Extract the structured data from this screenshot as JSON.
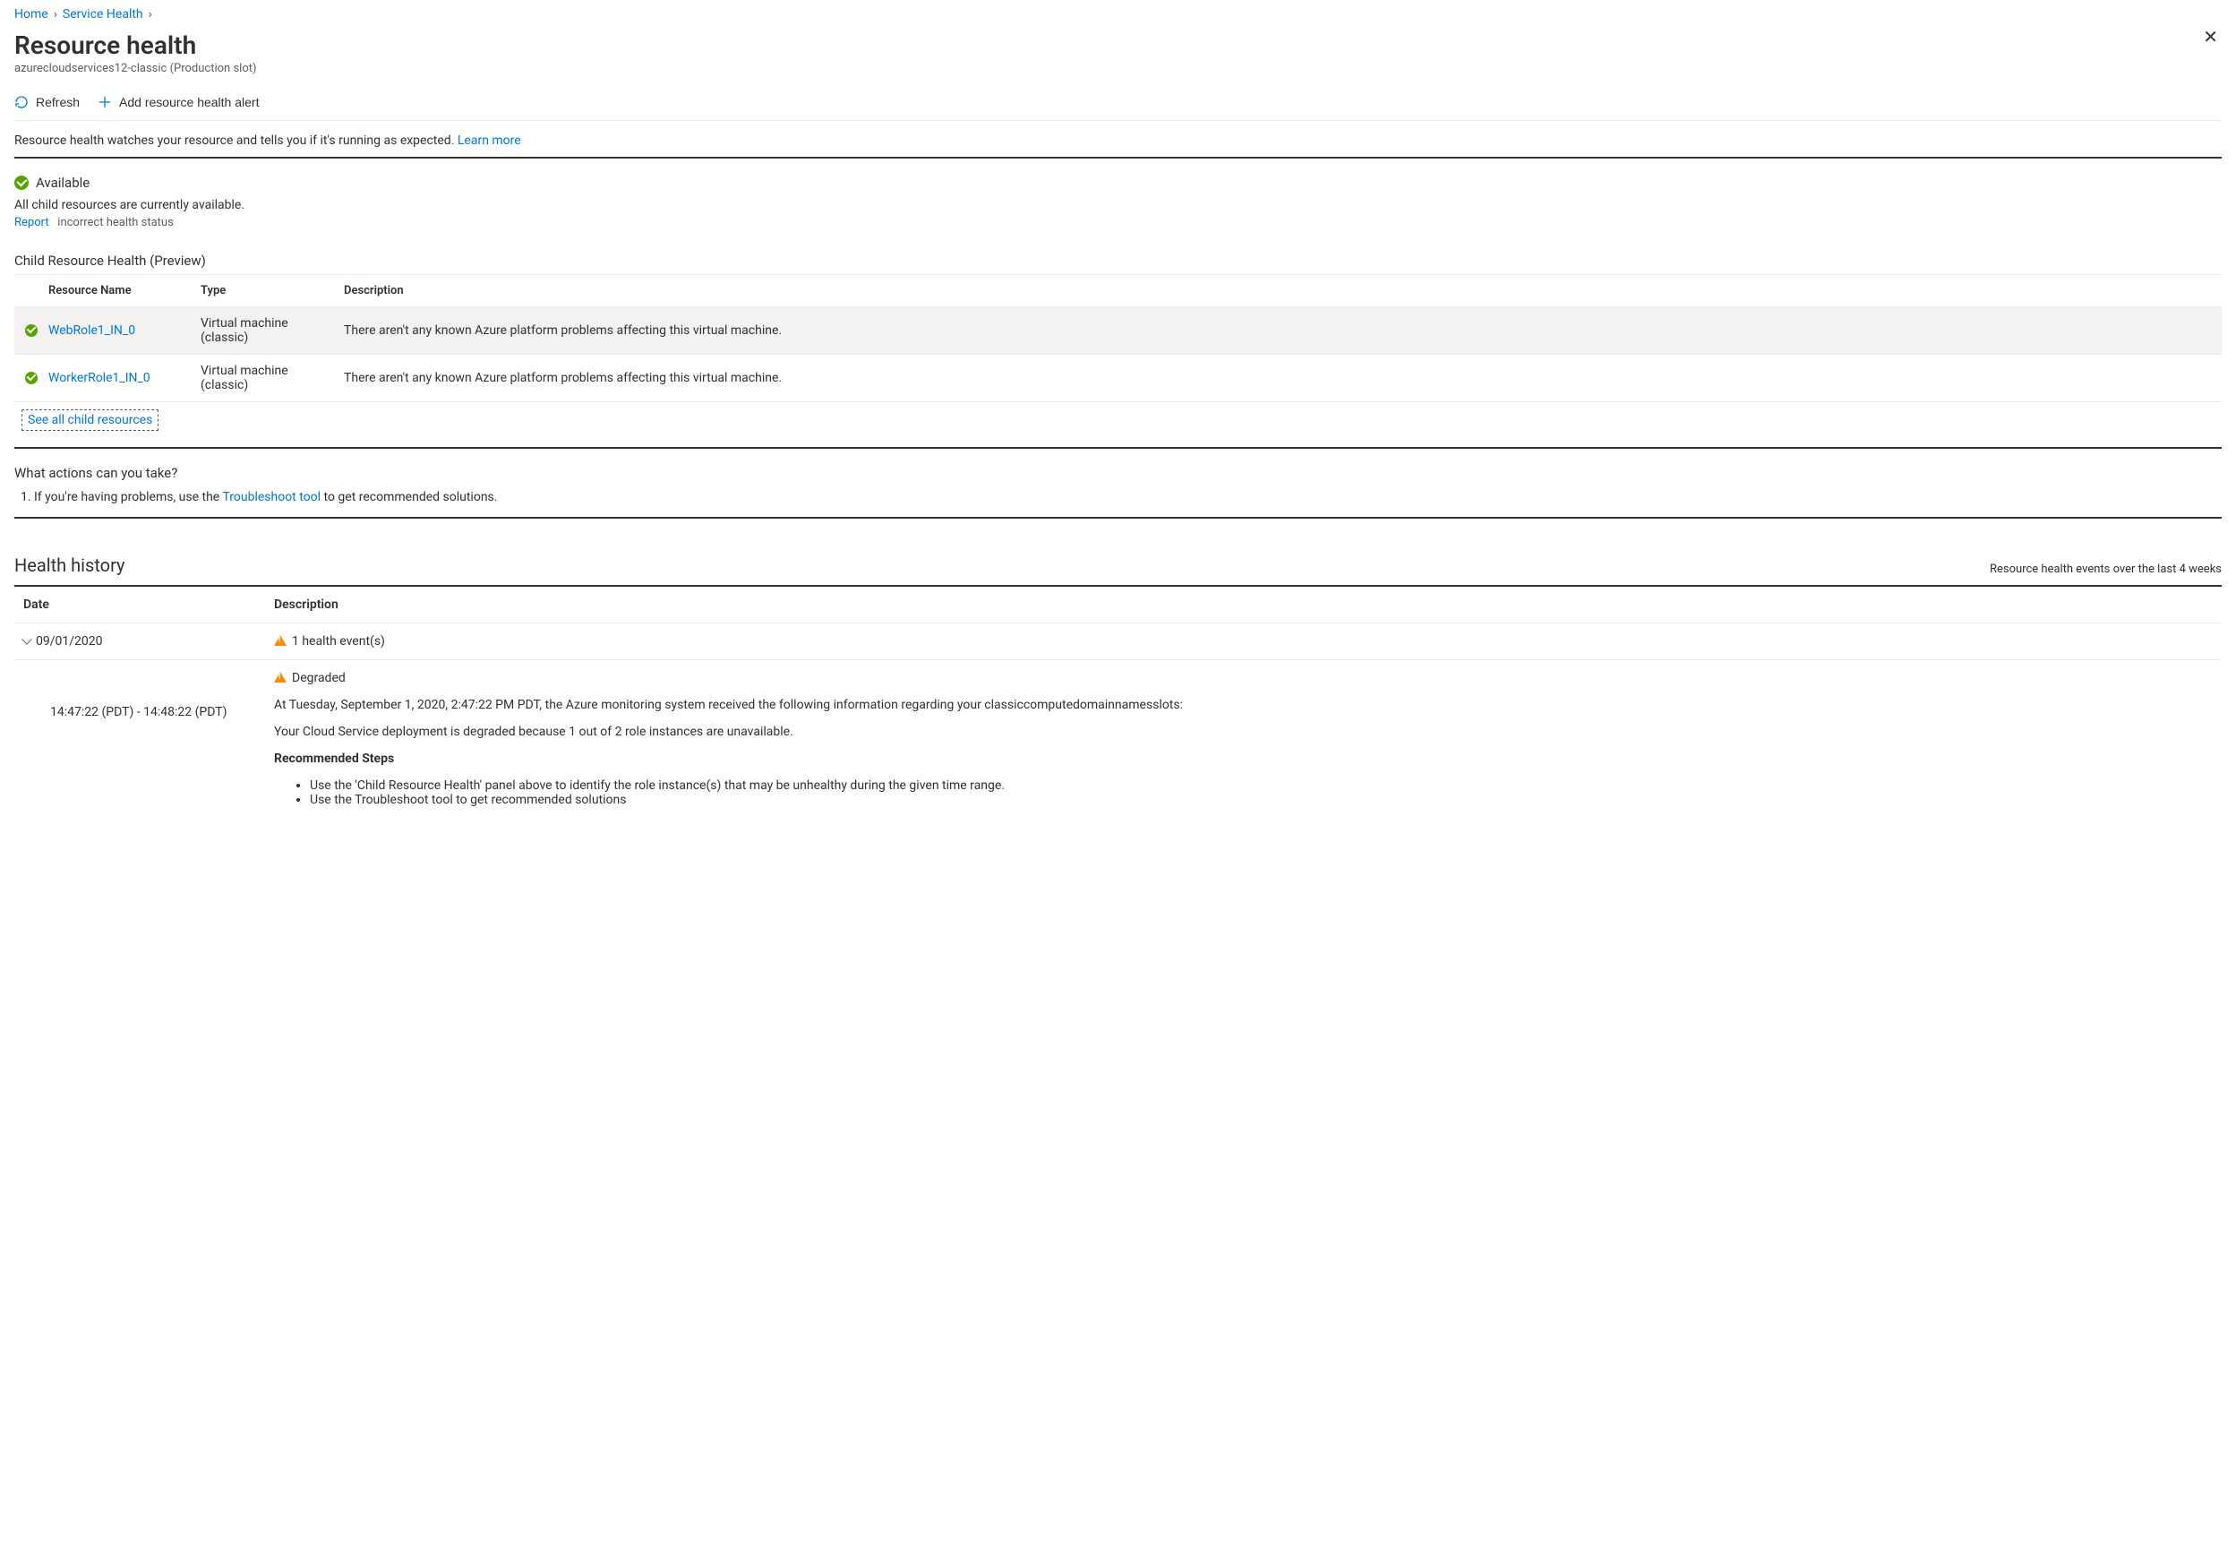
{
  "breadcrumb": {
    "home": "Home",
    "service_health": "Service Health"
  },
  "header": {
    "title": "Resource health",
    "subtitle": "azurecloudservices12-classic (Production slot)"
  },
  "toolbar": {
    "refresh": "Refresh",
    "add_alert": "Add resource health alert"
  },
  "intro": {
    "text": "Resource health watches your resource and tells you if it's running as expected. ",
    "learn_more": "Learn more"
  },
  "status": {
    "label": "Available",
    "sub": "All child resources are currently available.",
    "report_link": "Report",
    "report_text": "incorrect health status"
  },
  "child_section_title": "Child Resource Health (Preview)",
  "child_table": {
    "headers": {
      "name": "Resource Name",
      "type": "Type",
      "desc": "Description"
    },
    "rows": [
      {
        "name": "WebRole1_IN_0",
        "type": "Virtual machine (classic)",
        "desc": "There aren't any known Azure platform problems affecting this virtual machine."
      },
      {
        "name": "WorkerRole1_IN_0",
        "type": "Virtual machine (classic)",
        "desc": "There aren't any known Azure platform problems affecting this virtual machine."
      }
    ],
    "see_all": "See all child resources"
  },
  "actions": {
    "title": "What actions can you take?",
    "item_prefix": "If you're having problems, use the ",
    "item_link": "Troubleshoot tool",
    "item_suffix": " to get recommended solutions."
  },
  "history": {
    "title": "Health history",
    "range": "Resource health events over the last 4 weeks",
    "headers": {
      "date": "Date",
      "desc": "Description"
    },
    "rows": [
      {
        "date": "09/01/2020",
        "summary": "1 health event(s)"
      }
    ],
    "event": {
      "time_range": "14:47:22 (PDT) - 14:48:22 (PDT)",
      "status": "Degraded",
      "line1": "At Tuesday, September 1, 2020, 2:47:22 PM PDT, the Azure monitoring system received the following information regarding your classiccomputedomainnamesslots:",
      "line2": "Your Cloud Service deployment is degraded because 1 out of 2 role instances are unavailable.",
      "steps_title": "Recommended Steps",
      "step1": "Use the 'Child Resource Health' panel above to identify the role instance(s) that may be unhealthy during the given time range.",
      "step2_prefix": "Use the ",
      "step2_link": "Troubleshoot tool",
      "step2_suffix": " to get recommended solutions"
    }
  }
}
